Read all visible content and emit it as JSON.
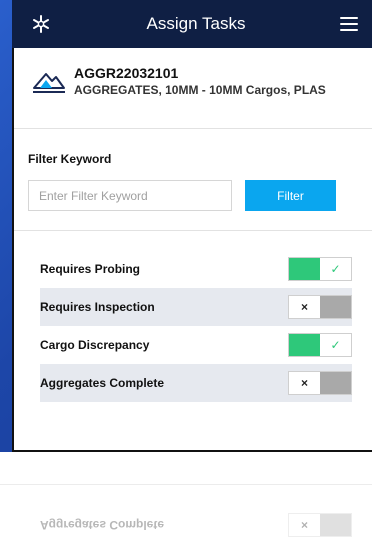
{
  "header": {
    "title": "Assign Tasks",
    "logo_icon": "asterisk-logo-icon",
    "menu_icon": "hamburger-menu-icon",
    "bg_color": "#0f1f44"
  },
  "cargo": {
    "icon": "mountain-aggregates-icon",
    "id": "AGGR22032101",
    "description": "AGGREGATES, 10MM - 10MM Cargos, PLAS"
  },
  "filter": {
    "label": "Filter Keyword",
    "placeholder": "Enter Filter Keyword",
    "value": "",
    "button_label": "Filter",
    "button_color": "#0aa6ef"
  },
  "tasks": [
    {
      "label": "Requires Probing",
      "enabled": true
    },
    {
      "label": "Requires Inspection",
      "enabled": false
    },
    {
      "label": "Cargo Discrepancy",
      "enabled": true
    },
    {
      "label": "Aggregates Complete",
      "enabled": false
    }
  ],
  "toggle": {
    "on_glyph": "✓",
    "off_glyph": "×",
    "on_color": "#2ec87a",
    "off_color": "#a9a9a9"
  },
  "reflection": {
    "label": "Aggregates Complete"
  }
}
